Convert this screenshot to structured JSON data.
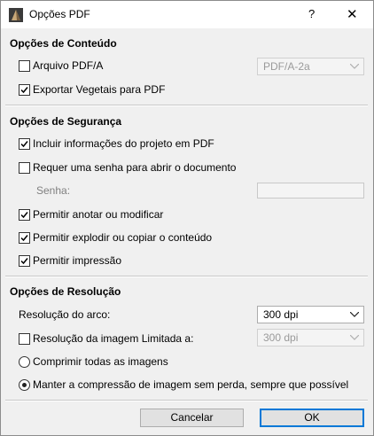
{
  "window": {
    "title": "Opções PDF",
    "help_label": "?",
    "close_label": "✕"
  },
  "content_section": {
    "title": "Opções de Conteúdo",
    "pdfa": {
      "label": "Arquivo PDF/A",
      "checked": false,
      "select_value": "PDF/A-2a"
    },
    "export_vegetation": {
      "label": "Exportar Vegetais para PDF",
      "checked": true
    }
  },
  "security_section": {
    "title": "Opções de Segurança",
    "include_project_info": {
      "label": "Incluir informações do projeto em PDF",
      "checked": true
    },
    "require_password": {
      "label": "Requer uma senha para abrir o documento",
      "checked": false
    },
    "password_label": "Senha:",
    "allow_annotate": {
      "label": "Permitir anotar ou modificar",
      "checked": true
    },
    "allow_explode": {
      "label": "Permitir explodir ou copiar o conteúdo",
      "checked": true
    },
    "allow_print": {
      "label": "Permitir impressão",
      "checked": true
    }
  },
  "resolution_section": {
    "title": "Opções de Resolução",
    "arc_resolution_label": "Resolução do arco:",
    "arc_resolution_value": "300 dpi",
    "limit_image_resolution": {
      "label": "Resolução da imagem Limitada a:",
      "checked": false,
      "select_value": "300 dpi"
    },
    "compress_all": {
      "label": "Comprimir todas as imagens",
      "selected": false
    },
    "keep_lossless": {
      "label": "Manter a compressão de imagem sem perda, sempre que possível",
      "selected": true
    }
  },
  "buttons": {
    "cancel": "Cancelar",
    "ok": "OK"
  },
  "colors": {
    "accent": "#0078d7",
    "window_bg": "#f0f0f0"
  }
}
